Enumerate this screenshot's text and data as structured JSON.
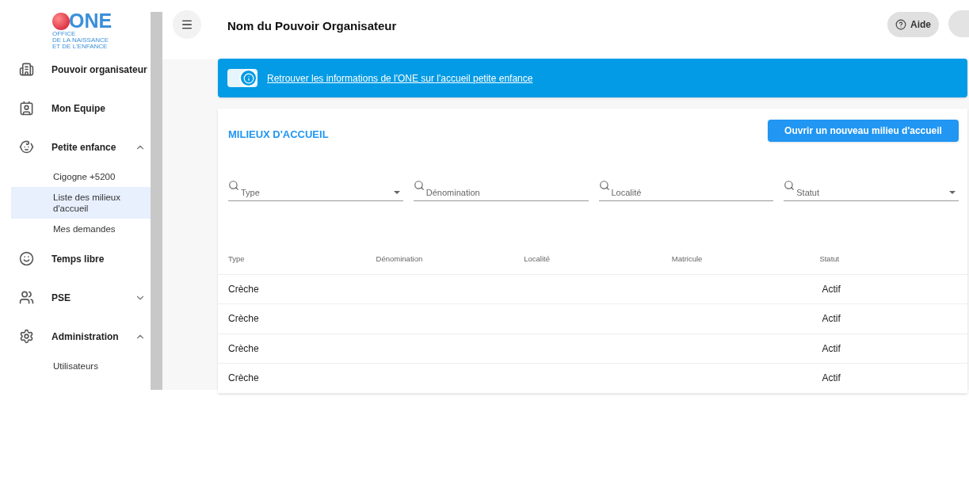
{
  "logo": {
    "mark": "ONE",
    "subtitle": [
      "OFFICE",
      "DE LA NAISSANCE",
      "ET DE L'ENFANCE"
    ]
  },
  "sidebar": {
    "items": [
      {
        "label": "Pouvoir organisateur",
        "kind": "link"
      },
      {
        "label": "Mon Equipe",
        "kind": "link"
      },
      {
        "label": "Petite enfance",
        "kind": "group",
        "expanded": true,
        "children": [
          {
            "label": "Cigogne +5200",
            "selected": false
          },
          {
            "label": "Liste des milieux d'accueil",
            "selected": true
          },
          {
            "label": "Mes demandes",
            "selected": false
          }
        ]
      },
      {
        "label": "Temps libre",
        "kind": "link"
      },
      {
        "label": "PSE",
        "kind": "group",
        "expanded": false
      },
      {
        "label": "Administration",
        "kind": "group",
        "expanded": true,
        "children": [
          {
            "label": "Utilisateurs",
            "selected": false
          }
        ]
      }
    ]
  },
  "header": {
    "title": "Nom du Pouvoir Organisateur",
    "help": "Aide"
  },
  "banner": {
    "toggle_on": false,
    "link": "Retrouver les informations de l'ONE sur l'accueil petite enfance"
  },
  "card": {
    "title": "MILIEUX D'ACCUEIL",
    "button": "Ouvrir un nouveau milieu d'accueil",
    "filters": [
      {
        "placeholder": "Type",
        "kind": "select"
      },
      {
        "placeholder": "Dénomination",
        "kind": "text"
      },
      {
        "placeholder": "Localité",
        "kind": "text"
      },
      {
        "placeholder": "Statut",
        "kind": "select"
      }
    ],
    "table": {
      "columns": [
        "Type",
        "Dénomination",
        "Localité",
        "Matricule",
        "Statut"
      ],
      "rows": [
        [
          "Crèche",
          "",
          "",
          "",
          "Actif"
        ],
        [
          "Crèche",
          "",
          "",
          "",
          "Actif"
        ],
        [
          "Crèche",
          "",
          "",
          "",
          "Actif"
        ],
        [
          "Crèche",
          "",
          "",
          "",
          "Actif"
        ]
      ]
    }
  }
}
